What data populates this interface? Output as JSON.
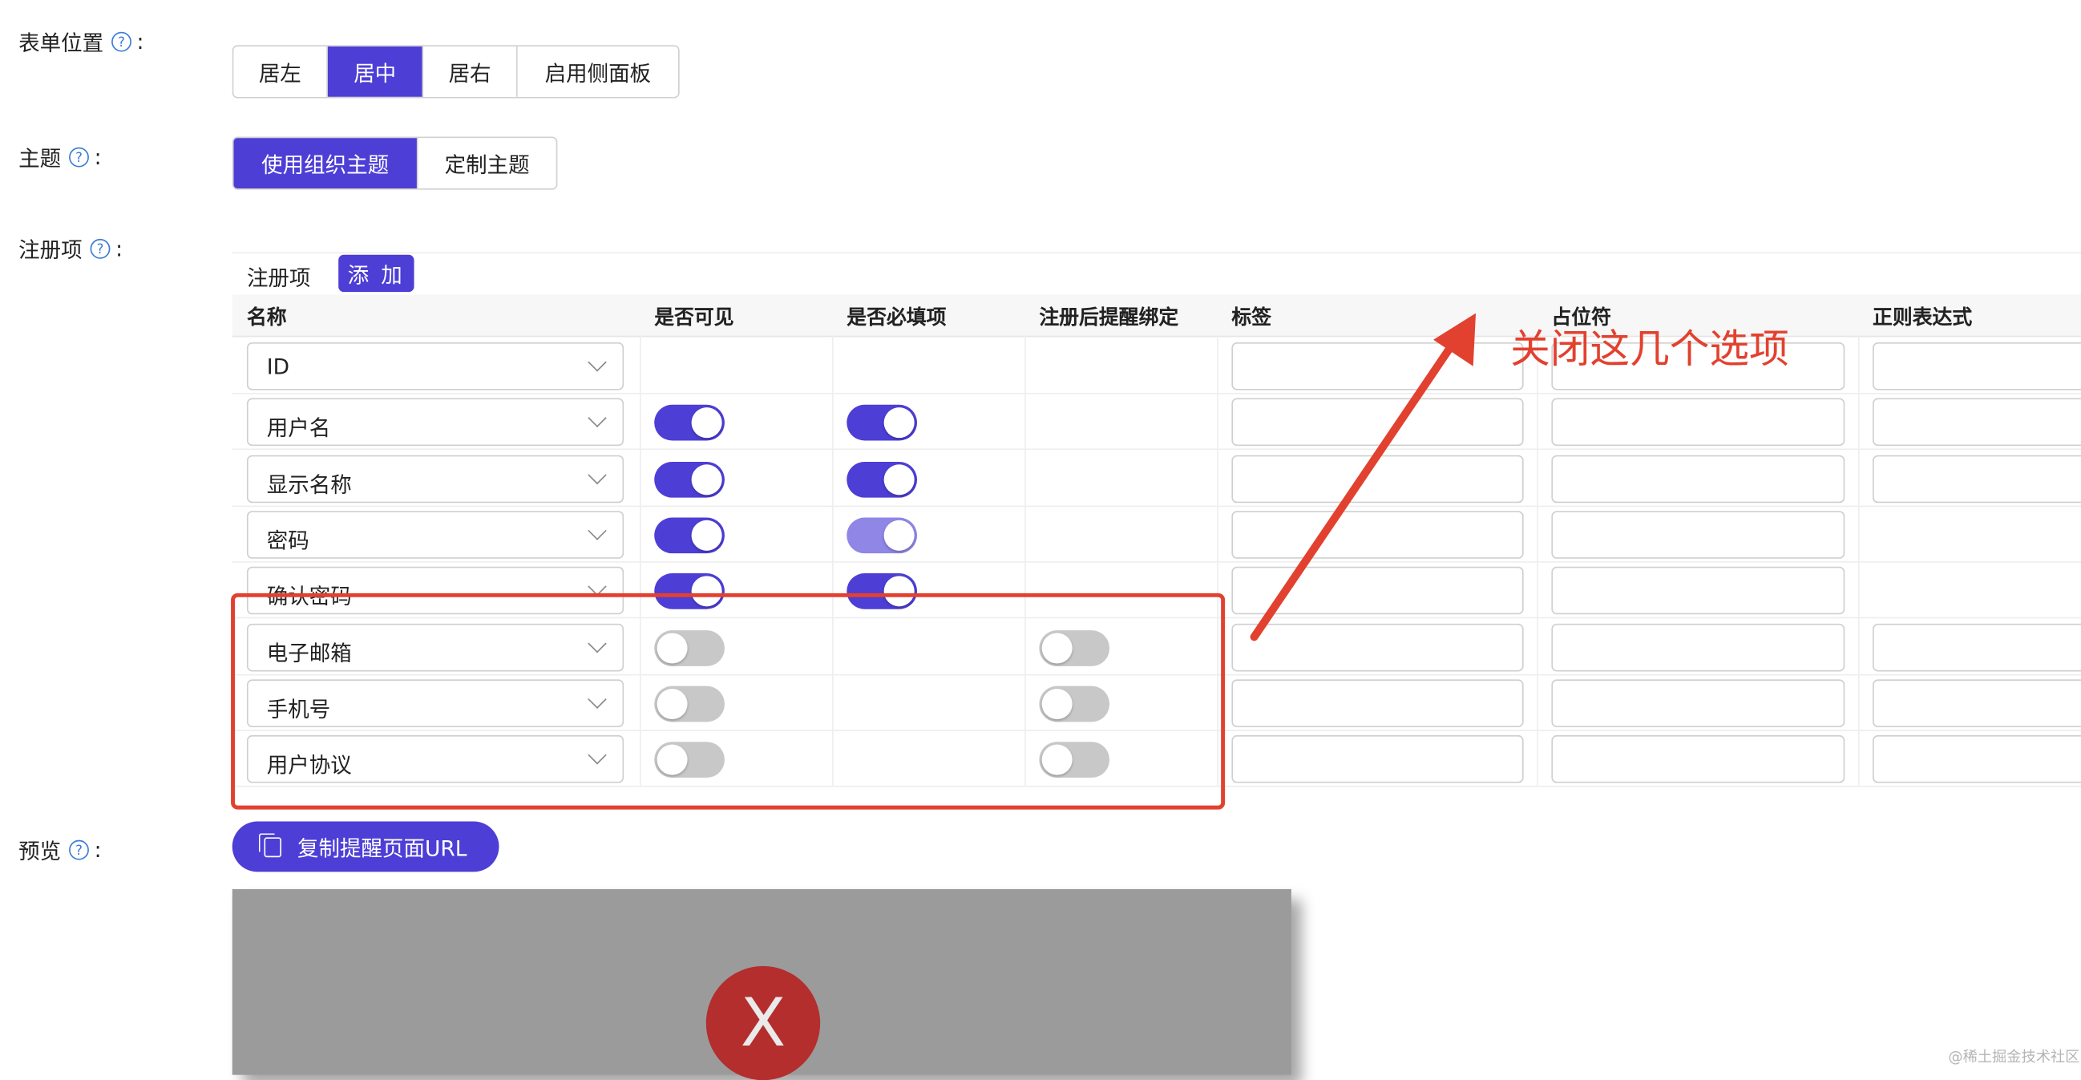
{
  "form_position": {
    "label": "表单位置",
    "options": [
      "居左",
      "居中",
      "居右",
      "启用侧面板"
    ],
    "selected": "居中"
  },
  "theme": {
    "label": "主题",
    "options": [
      "使用组织主题",
      "定制主题"
    ],
    "selected": "使用组织主题"
  },
  "registration": {
    "label": "注册项",
    "section_title": "注册项",
    "add_label": "添 加",
    "columns": [
      "名称",
      "是否可见",
      "是否必填项",
      "注册后提醒绑定",
      "标签",
      "占位符",
      "正则表达式"
    ],
    "rows": [
      {
        "name": "ID",
        "visible": null,
        "required": null,
        "remind_bind": null
      },
      {
        "name": "用户名",
        "visible": "on",
        "required": "on",
        "remind_bind": null
      },
      {
        "name": "显示名称",
        "visible": "on",
        "required": "on",
        "remind_bind": null
      },
      {
        "name": "密码",
        "visible": "on",
        "required": "on-disabled",
        "remind_bind": null
      },
      {
        "name": "确认密码",
        "visible": "on",
        "required": "on",
        "remind_bind": null
      },
      {
        "name": "电子邮箱",
        "visible": "off",
        "required": null,
        "remind_bind": "off"
      },
      {
        "name": "手机号",
        "visible": "off",
        "required": null,
        "remind_bind": "off"
      },
      {
        "name": "用户协议",
        "visible": "off",
        "required": null,
        "remind_bind": "off"
      }
    ]
  },
  "annotation": {
    "text": "关闭这几个选项",
    "color": "#e2412f"
  },
  "preview": {
    "label": "预览",
    "copy_button": "复制提醒页面URL",
    "error_glyph": "X"
  },
  "help_icon_glyph": "?",
  "label_suffix": ":",
  "watermark": "@稀土掘金技术社区",
  "colors": {
    "primary": "#4d3ed6",
    "annotation": "#e2412f"
  }
}
